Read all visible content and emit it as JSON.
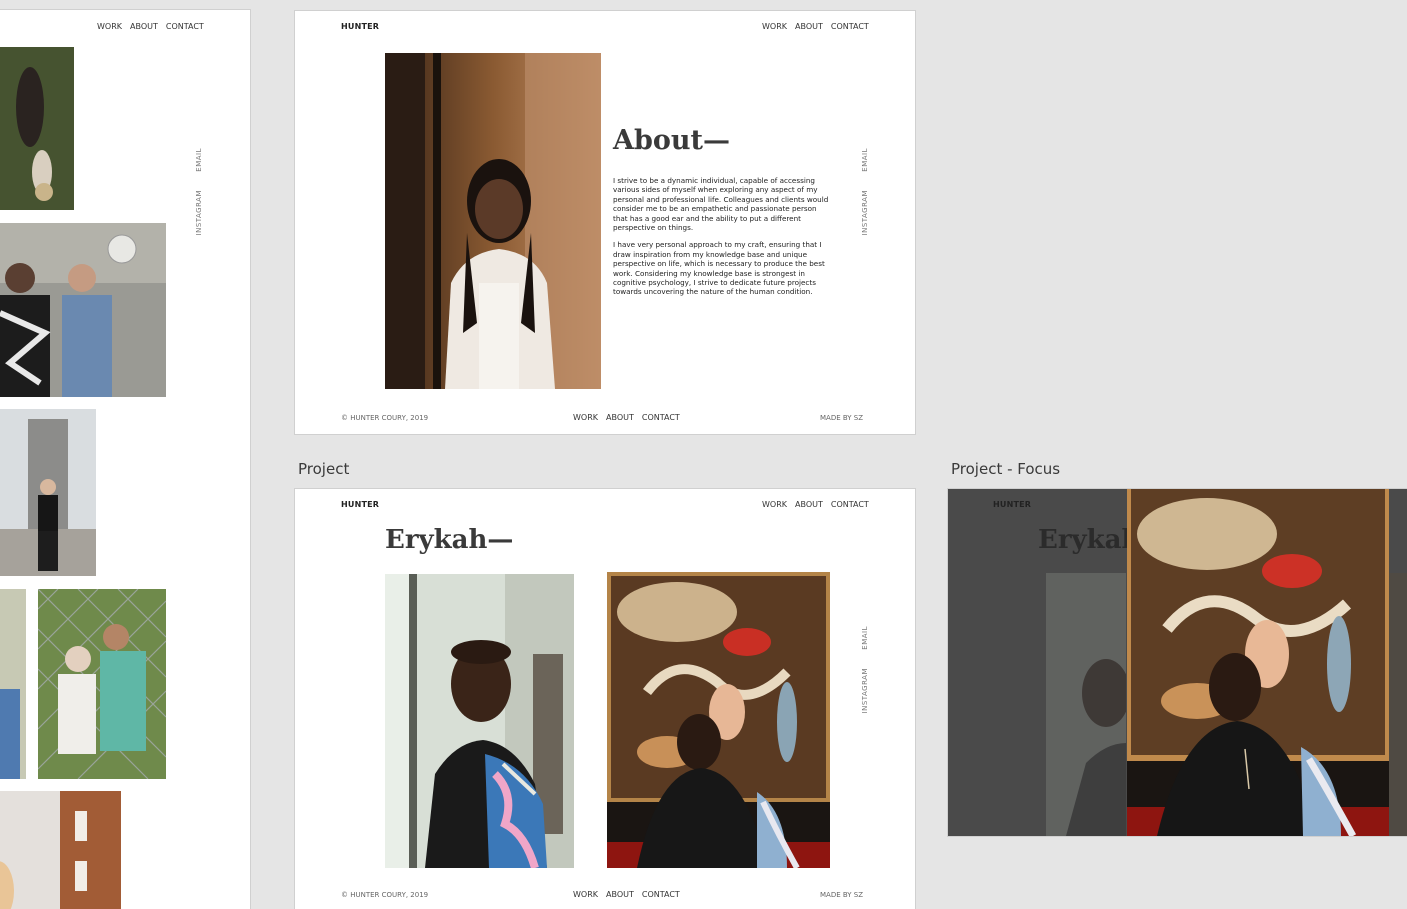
{
  "nav": {
    "work": "WORK",
    "about": "ABOUT",
    "contact": "CONTACT"
  },
  "brand": "HUNTER",
  "social": {
    "email": "EMAIL",
    "instagram": "INSTAGRAM"
  },
  "footer": {
    "copyright": "© HUNTER COURY, 2019",
    "credit": "MADE BY SZ"
  },
  "about": {
    "heading": "About—",
    "paragraphs": [
      "I strive to be a dynamic individual, capable of accessing various sides of myself when exploring any aspect of my personal and professional life. Colleagues and clients would consider me to be an empathetic and passionate person that has a good ear and the ability to put a different perspective on things.",
      "I have very personal approach to my craft, ensuring that I draw inspiration from my knowledge base and unique perspective on life, which is necessary to produce the best work. Considering my knowledge base is strongest in cognitive psychology, I strive to dedicate future projects towards uncovering the nature of the human condition."
    ]
  },
  "artboards": {
    "project_label": "Project",
    "focus_label": "Project - Focus"
  },
  "project": {
    "heading": "Erykah—"
  },
  "focus": {
    "heading": "Erykah"
  }
}
